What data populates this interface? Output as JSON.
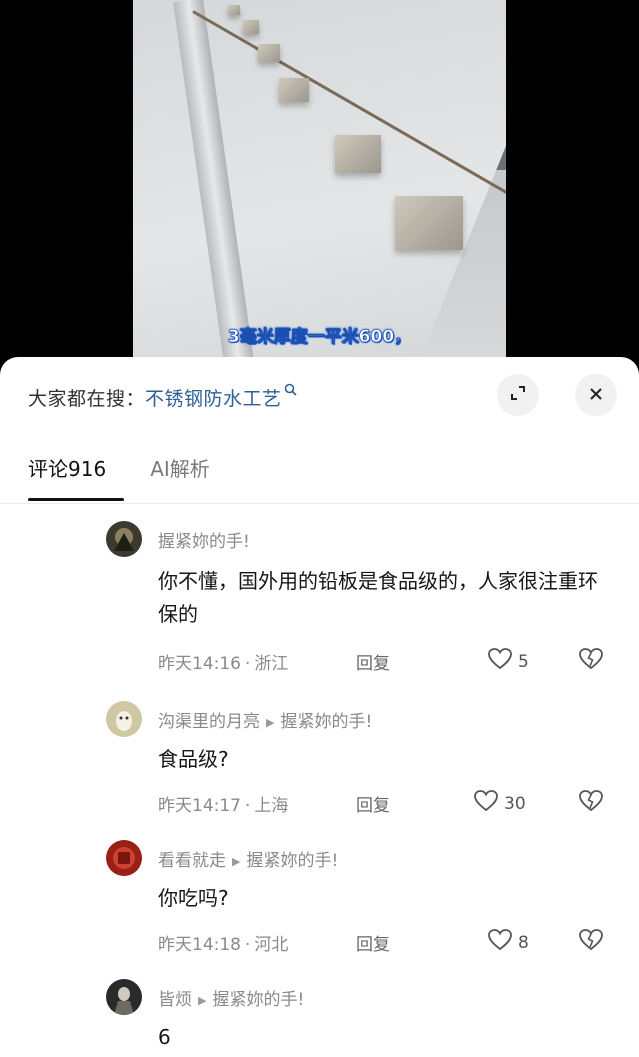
{
  "video": {
    "subtitle": "3毫米厚度一平米600，"
  },
  "sheet": {
    "search_prefix": "大家都在搜：",
    "search_term": "不锈钢防水工艺",
    "tabs": [
      {
        "label": "评论916",
        "active": true
      },
      {
        "label": "AI解析",
        "active": false
      }
    ]
  },
  "comments": [
    {
      "user": "握紧妳的手!",
      "reply_to": "",
      "text": "你不懂，国外用的铅板是食品级的，人家很注重环保的",
      "time": "昨天14:16",
      "location": "浙江",
      "reply_label": "回复",
      "likes": "5",
      "avatar_color": "#3c3a2e"
    },
    {
      "user": "沟渠里的月亮",
      "reply_to": "握紧妳的手!",
      "text": "食品级?",
      "time": "昨天14:17",
      "location": "上海",
      "reply_label": "回复",
      "likes": "30",
      "avatar_color": "#cfc8a2"
    },
    {
      "user": "看看就走",
      "reply_to": "握紧妳的手!",
      "text": "你吃吗?",
      "time": "昨天14:18",
      "location": "河北",
      "reply_label": "回复",
      "likes": "8",
      "avatar_color": "#9a1f14"
    },
    {
      "user": "皆烦",
      "reply_to": "握紧妳的手!",
      "text": "6",
      "avatar_color": "#2a2a2a"
    }
  ]
}
